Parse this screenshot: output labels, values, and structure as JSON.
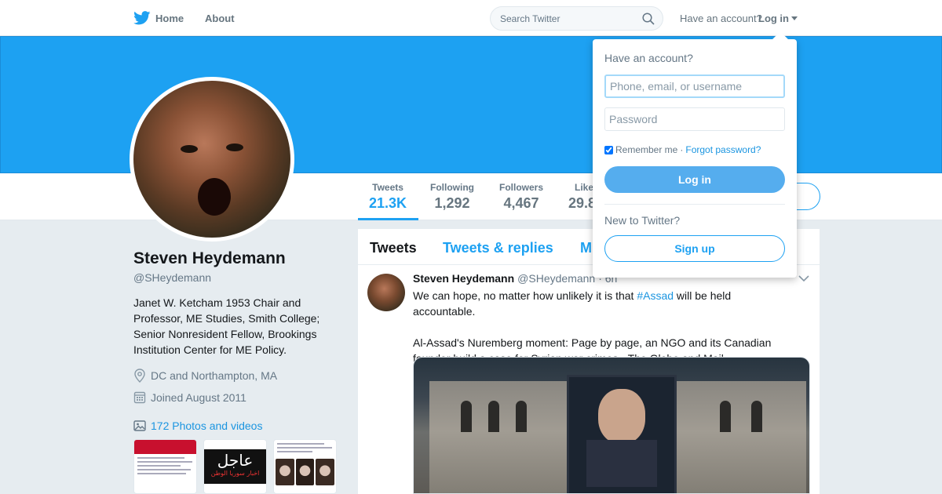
{
  "nav": {
    "home_label": "Home",
    "about_label": "About",
    "search_placeholder": "Search Twitter",
    "have_account": "Have an account?",
    "login_label": "Log in"
  },
  "profile": {
    "name": "Steven Heydemann",
    "handle": "@SHeydemann",
    "bio": "Janet W. Ketcham 1953 Chair and Professor, ME Studies, Smith College; Senior Nonresident Fellow, Brookings Institution Center for ME Policy.",
    "location": "DC and Northampton, MA",
    "joined": "Joined August 2011",
    "photos_link": "172 Photos and videos"
  },
  "stats": [
    {
      "label": "Tweets",
      "value": "21.3K"
    },
    {
      "label": "Following",
      "value": "1,292"
    },
    {
      "label": "Followers",
      "value": "4,467"
    },
    {
      "label": "Like",
      "value": "29.8"
    }
  ],
  "timeline": {
    "tabs": [
      "Tweets",
      "Tweets & replies",
      "M"
    ],
    "tweet": {
      "name": "Steven Heydemann",
      "handle": "@SHeydemann",
      "time": "· 6h",
      "text_before": "We can hope, no matter how unlikely it is that ",
      "hashtag": "#Assad",
      "text_after": " will be held accountable.",
      "text_second": "Al-Assad's Nuremberg moment: Page by page, an NGO and its Canadian founder build a case for Syrian war crimes - The Globe and Mail"
    }
  },
  "thumbs": {
    "thumb2_text": "عاجل",
    "thumb2_sub": "اخبار سوريا الوطن"
  },
  "login_dropdown": {
    "title": "Have an account?",
    "username_placeholder": "Phone, email, or username",
    "password_placeholder": "Password",
    "remember_label": "Remember me",
    "separator": " · ",
    "forgot_label": "Forgot password?",
    "login_button": "Log in",
    "new_label": "New to Twitter?",
    "signup_button": "Sign up"
  },
  "colors": {
    "brand": "#1da1f2",
    "link": "#1b95e0",
    "login_button": "#55adee"
  }
}
